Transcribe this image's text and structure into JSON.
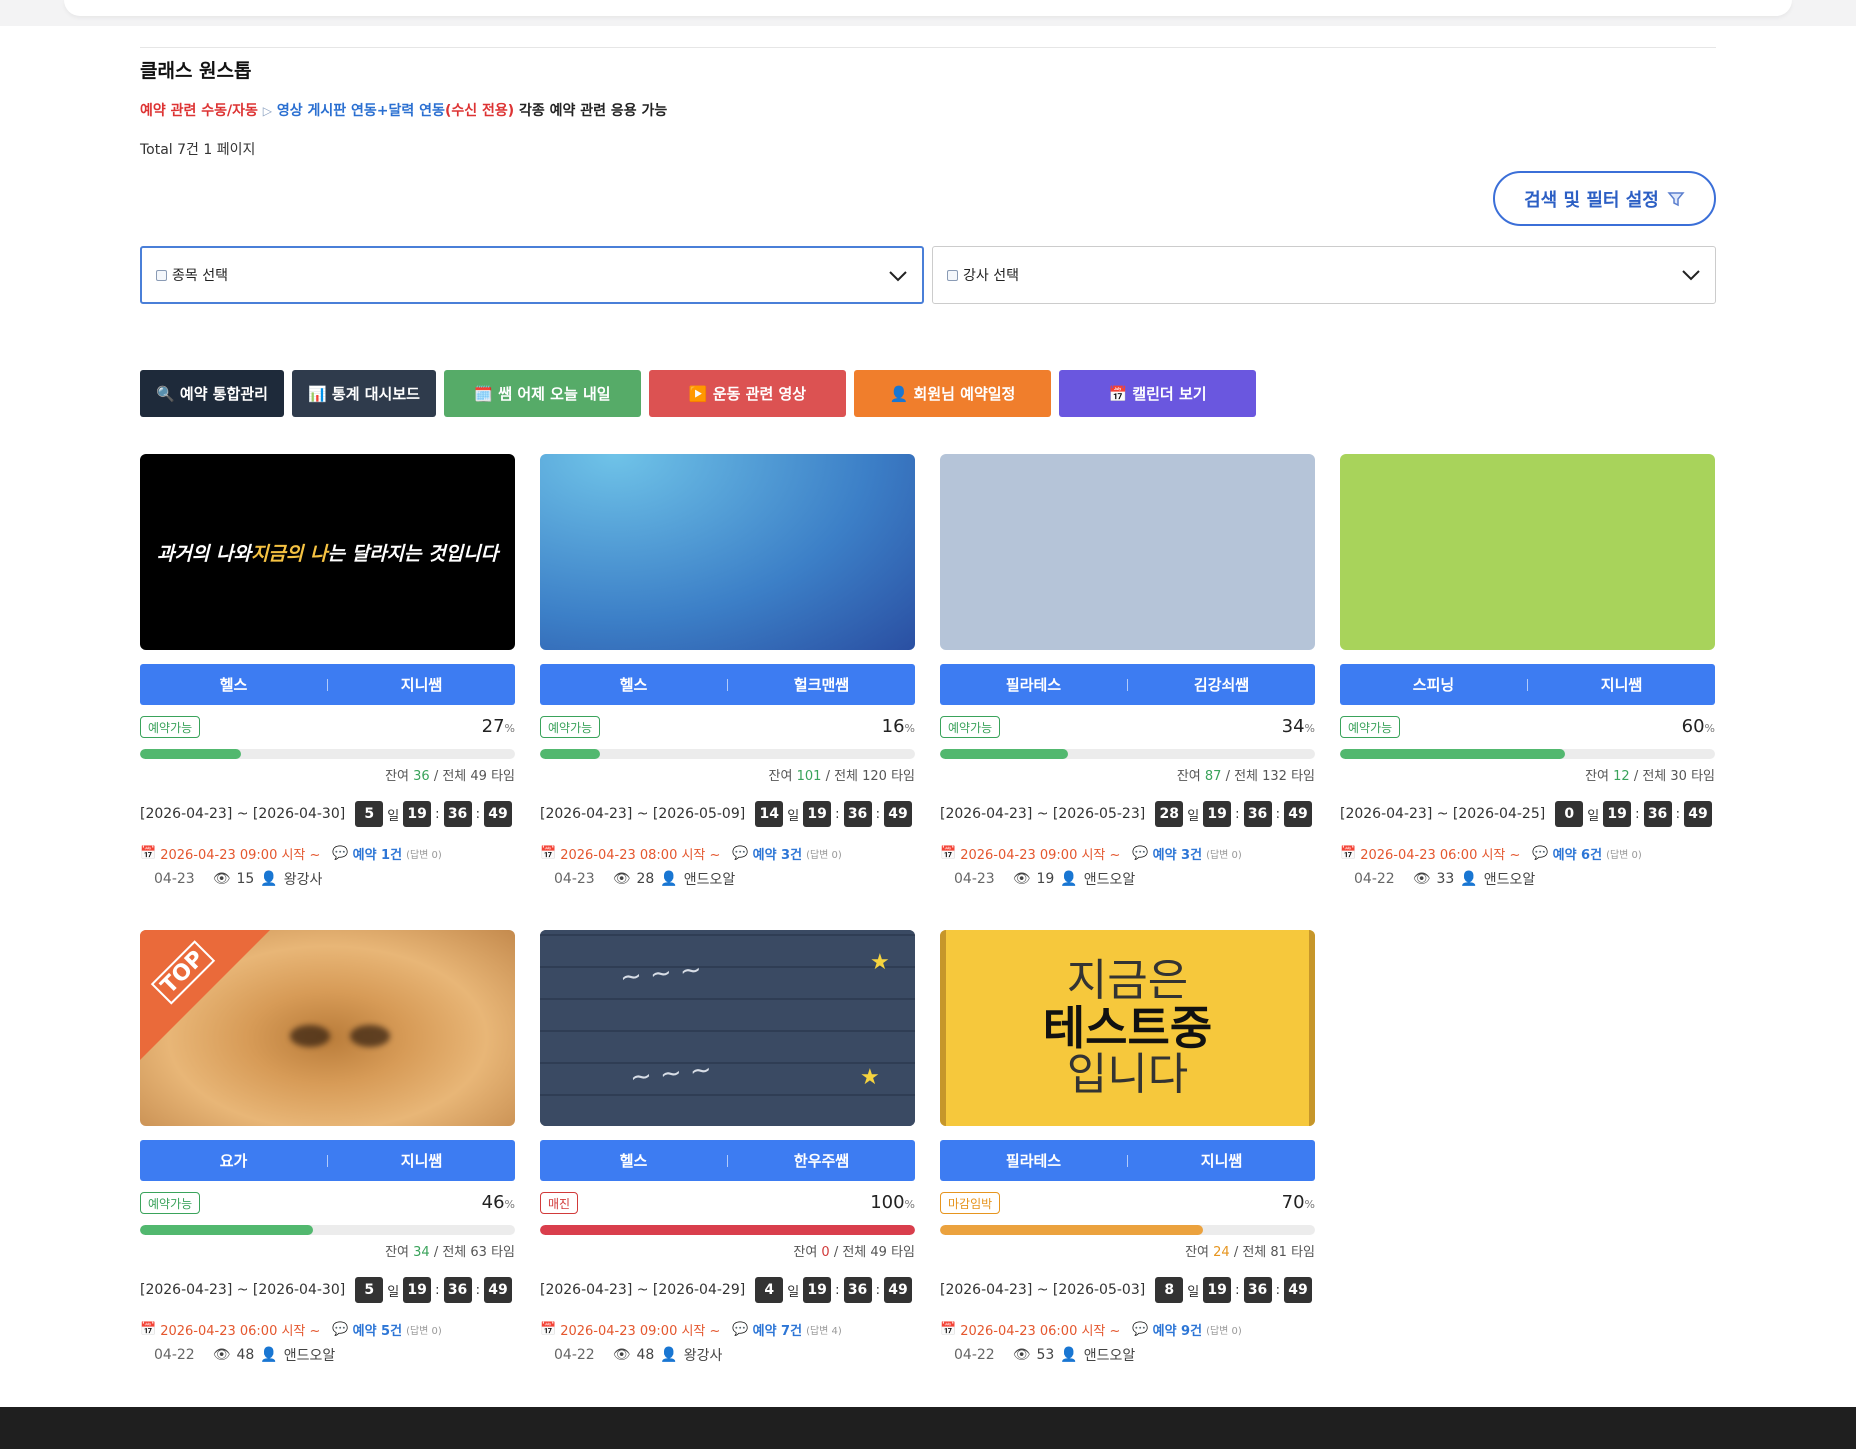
{
  "board": {
    "title": "클래스 원스톱",
    "notice": {
      "part1": "예약 관련 수동/자동",
      "part2": "영상 게시판 연동+달력 연동",
      "part3": "(수신 전용)",
      "part4": "각종 예약 관련 응용 가능"
    },
    "total": "Total 7건 1 페이지",
    "filter_button": "검색 및 필터 설정"
  },
  "selects": [
    {
      "label": "종목 선택"
    },
    {
      "label": "강사 선택"
    }
  ],
  "toolbar": [
    {
      "label": "🔍 예약 통합관리",
      "color": "#1e2a3a"
    },
    {
      "label": "📊 통계 대시보드",
      "color": "#2f3b4c"
    },
    {
      "label": "🗓️ 쌤 어제 오늘 내일",
      "color": "#56ab68"
    },
    {
      "label": "▶️ 운동 관련 영상",
      "color": "#dc5252"
    },
    {
      "label": "👤 회원님 예약일정",
      "color": "#f07e2c"
    },
    {
      "label": "📅 캘린더 보기",
      "color": "#6a57df"
    }
  ],
  "colors": {
    "accent": "#3d7cf2",
    "ok": "#52b86f",
    "full": "#d93e4c",
    "soon": "#eba23e"
  },
  "cards": [
    {
      "thumb_text_a": "과거의 나와 ",
      "thumb_text_b": "지금의 나",
      "thumb_text_c": "는 달라지는 것입니다",
      "category": "헬스",
      "teacher": "지니쌤",
      "status": "예약가능",
      "status_kind": "ok",
      "percent": 27,
      "pct_unit": "%",
      "remain_label": "잔여 ",
      "remain": "36",
      "total": " / 전체 49 타임",
      "period": "[2026-04-23] ~ [2026-04-30]",
      "d": "5",
      "day_unit": "일",
      "h": "19",
      "m": "36",
      "s": "49",
      "start": "2026-04-23 09:00 시작 ~",
      "reserve": "예약 1건",
      "answer": "(답변 0)",
      "date": "04-23",
      "views": "15",
      "author": "왕강사"
    },
    {
      "category": "헬스",
      "teacher": "헐크맨쌤",
      "status": "예약가능",
      "status_kind": "ok",
      "percent": 16,
      "pct_unit": "%",
      "remain_label": "잔여 ",
      "remain": "101",
      "total": " / 전체 120 타임",
      "period": "[2026-04-23] ~ [2026-05-09]",
      "d": "14",
      "day_unit": "일",
      "h": "19",
      "m": "36",
      "s": "49",
      "start": "2026-04-23 08:00 시작 ~",
      "reserve": "예약 3건",
      "answer": "(답변 0)",
      "date": "04-23",
      "views": "28",
      "author": "앤드오알"
    },
    {
      "category": "필라테스",
      "teacher": "김강쇠쌤",
      "status": "예약가능",
      "status_kind": "ok",
      "percent": 34,
      "pct_unit": "%",
      "remain_label": "잔여 ",
      "remain": "87",
      "total": " / 전체 132 타임",
      "period": "[2026-04-23] ~ [2026-05-23]",
      "d": "28",
      "day_unit": "일",
      "h": "19",
      "m": "36",
      "s": "49",
      "start": "2026-04-23 09:00 시작 ~",
      "reserve": "예약 3건",
      "answer": "(답변 0)",
      "date": "04-23",
      "views": "19",
      "author": "앤드오알"
    },
    {
      "category": "스피닝",
      "teacher": "지니쌤",
      "status": "예약가능",
      "status_kind": "ok",
      "percent": 60,
      "pct_unit": "%",
      "remain_label": "잔여 ",
      "remain": "12",
      "total": " / 전체 30 타임",
      "period": "[2026-04-23] ~ [2026-04-25]",
      "d": "0",
      "day_unit": "일",
      "h": "19",
      "m": "36",
      "s": "49",
      "start": "2026-04-23 06:00 시작 ~",
      "reserve": "예약 6건",
      "answer": "(답변 0)",
      "date": "04-22",
      "views": "33",
      "author": "앤드오알"
    },
    {
      "thumb_badge": "TOP",
      "category": "요가",
      "teacher": "지니쌤",
      "status": "예약가능",
      "status_kind": "ok",
      "percent": 46,
      "pct_unit": "%",
      "remain_label": "잔여 ",
      "remain": "34",
      "total": " / 전체 63 타임",
      "period": "[2026-04-23] ~ [2026-04-30]",
      "d": "5",
      "day_unit": "일",
      "h": "19",
      "m": "36",
      "s": "49",
      "start": "2026-04-23 06:00 시작 ~",
      "reserve": "예약 5건",
      "answer": "(답변 0)",
      "date": "04-22",
      "views": "48",
      "author": "앤드오알"
    },
    {
      "category": "헬스",
      "teacher": "한우주쌤",
      "status": "매진",
      "status_kind": "full",
      "percent": 100,
      "pct_unit": "%",
      "remain_label": "잔여 ",
      "remain": "0",
      "total": " / 전체 49 타임",
      "period": "[2026-04-23] ~ [2026-04-29]",
      "d": "4",
      "day_unit": "일",
      "h": "19",
      "m": "36",
      "s": "49",
      "start": "2026-04-23 09:00 시작 ~",
      "reserve": "예약 7건",
      "answer": "(답변 4)",
      "date": "04-22",
      "views": "48",
      "author": "왕강사"
    },
    {
      "thumb_text_1": "지금은",
      "thumb_text_2": "테스트중",
      "thumb_text_3": "입니다",
      "category": "필라테스",
      "teacher": "지니쌤",
      "status": "마감임박",
      "status_kind": "soon",
      "percent": 70,
      "pct_unit": "%",
      "remain_label": "잔여 ",
      "remain": "24",
      "total": " / 전체 81 타임",
      "period": "[2026-04-23] ~ [2026-05-03]",
      "d": "8",
      "day_unit": "일",
      "h": "19",
      "m": "36",
      "s": "49",
      "start": "2026-04-23 06:00 시작 ~",
      "reserve": "예약 9건",
      "answer": "(답변 0)",
      "date": "04-22",
      "views": "53",
      "author": "앤드오알"
    }
  ]
}
